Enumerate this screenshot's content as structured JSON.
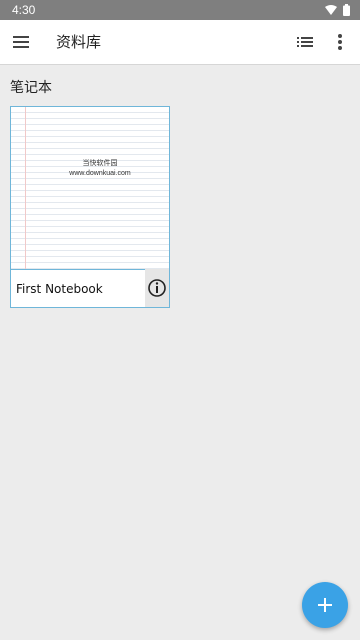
{
  "status_bar": {
    "time": "4:30",
    "background_color": "#7f7f7f",
    "icons": [
      "wifi-icon",
      "battery-icon"
    ]
  },
  "app_bar": {
    "title": "资料库",
    "icons": [
      "menu-icon",
      "list-view-icon",
      "more-vert-icon"
    ]
  },
  "section": {
    "title": "笔记本"
  },
  "notebooks": [
    {
      "name": "First Notebook",
      "cover_watermark": {
        "line1": "当快软件园",
        "line2": "www.downkuai.com"
      },
      "info_icon": "info-icon",
      "accent_color": "#6fb6d9"
    }
  ],
  "fab": {
    "icon": "plus-icon",
    "color": "#3aa2e6"
  }
}
